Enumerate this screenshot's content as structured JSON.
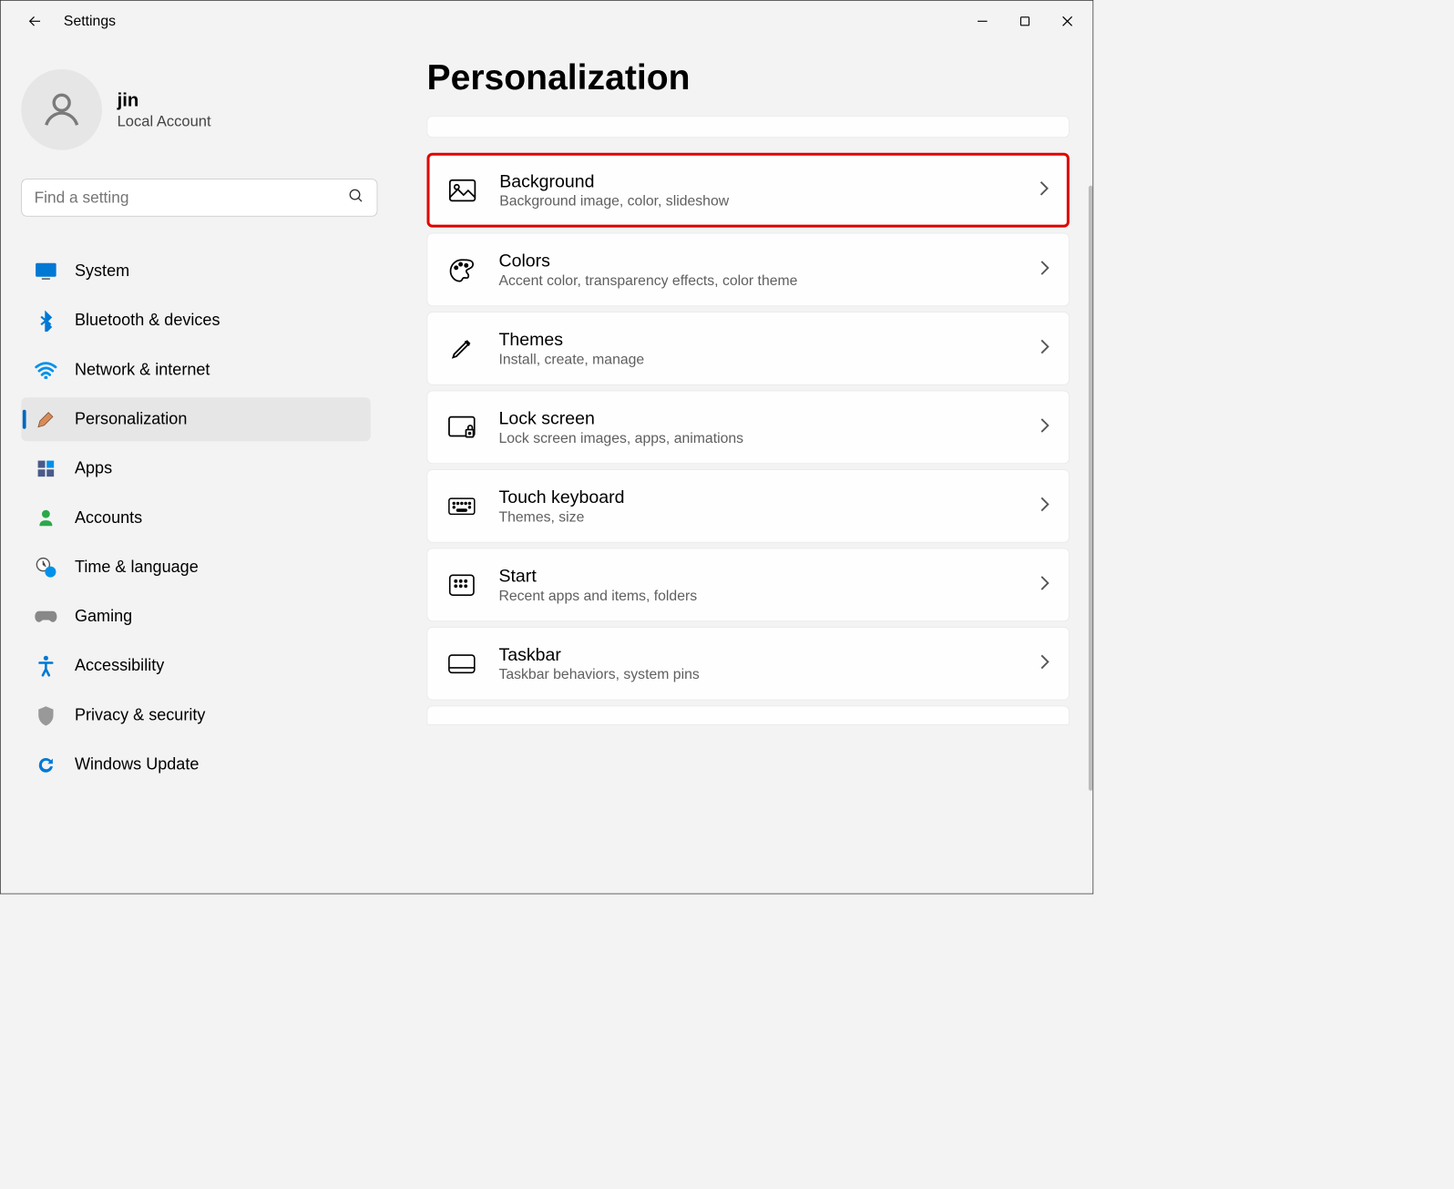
{
  "app_title": "Settings",
  "user": {
    "name": "jin",
    "type": "Local Account"
  },
  "search": {
    "placeholder": "Find a setting"
  },
  "sidebar": {
    "items": [
      {
        "id": "system",
        "label": "System",
        "selected": false
      },
      {
        "id": "bluetooth",
        "label": "Bluetooth & devices",
        "selected": false
      },
      {
        "id": "network",
        "label": "Network & internet",
        "selected": false
      },
      {
        "id": "personalization",
        "label": "Personalization",
        "selected": true
      },
      {
        "id": "apps",
        "label": "Apps",
        "selected": false
      },
      {
        "id": "accounts",
        "label": "Accounts",
        "selected": false
      },
      {
        "id": "time",
        "label": "Time & language",
        "selected": false
      },
      {
        "id": "gaming",
        "label": "Gaming",
        "selected": false
      },
      {
        "id": "accessibility",
        "label": "Accessibility",
        "selected": false
      },
      {
        "id": "privacy",
        "label": "Privacy & security",
        "selected": false
      },
      {
        "id": "update",
        "label": "Windows Update",
        "selected": false
      }
    ]
  },
  "main": {
    "title": "Personalization",
    "cards": [
      {
        "id": "background",
        "title": "Background",
        "subtitle": "Background image, color, slideshow",
        "highlighted": true
      },
      {
        "id": "colors",
        "title": "Colors",
        "subtitle": "Accent color, transparency effects, color theme",
        "highlighted": false
      },
      {
        "id": "themes",
        "title": "Themes",
        "subtitle": "Install, create, manage",
        "highlighted": false
      },
      {
        "id": "lockscreen",
        "title": "Lock screen",
        "subtitle": "Lock screen images, apps, animations",
        "highlighted": false
      },
      {
        "id": "touchkeyboard",
        "title": "Touch keyboard",
        "subtitle": "Themes, size",
        "highlighted": false
      },
      {
        "id": "start",
        "title": "Start",
        "subtitle": "Recent apps and items, folders",
        "highlighted": false
      },
      {
        "id": "taskbar",
        "title": "Taskbar",
        "subtitle": "Taskbar behaviors, system pins",
        "highlighted": false
      }
    ]
  }
}
